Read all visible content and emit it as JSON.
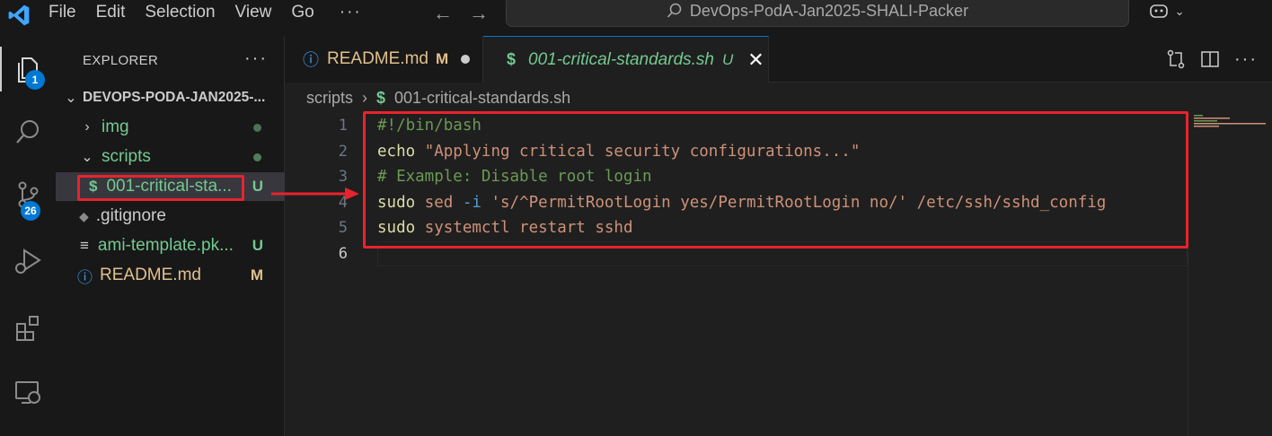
{
  "menu": {
    "items": [
      "File",
      "Edit",
      "Selection",
      "View",
      "Go"
    ],
    "more": "···"
  },
  "search": {
    "text": "DevOps-PodA-Jan2025-SHALI-Packer"
  },
  "activity_bar": {
    "explorer_badge": "1",
    "source_control_badge": "26"
  },
  "sidebar": {
    "title": "EXPLORER",
    "more": "···",
    "root": "DEVOPS-PODA-JAN2025-...",
    "items": [
      {
        "label": "img",
        "status": ""
      },
      {
        "label": "scripts",
        "status": ""
      },
      {
        "label": "001-critical-sta...",
        "status": "U"
      },
      {
        "label": ".gitignore",
        "status": ""
      },
      {
        "label": "ami-template.pk...",
        "status": "U"
      },
      {
        "label": "README.md",
        "status": "M"
      }
    ]
  },
  "tabs": [
    {
      "label": "README.md",
      "status": "M"
    },
    {
      "label": "001-critical-standards.sh",
      "status": "U"
    }
  ],
  "breadcrumb": {
    "folder": "scripts",
    "file": "001-critical-standards.sh"
  },
  "code": {
    "line_numbers": [
      "1",
      "2",
      "3",
      "4",
      "5",
      "6"
    ],
    "line1": "#!/bin/bash",
    "line2_cmd": "echo",
    "line2_str": "\"Applying critical security configurations...\"",
    "line3": "# Example: Disable root login",
    "line4_cmd": "sudo",
    "line4_arg": "sed",
    "line4_flag": "-i",
    "line4_str": "'s/^PermitRootLogin yes/PermitRootLogin no/'",
    "line4_path": "/etc/ssh/sshd_config",
    "line5_cmd": "sudo",
    "line5_rest": "systemctl restart sshd"
  },
  "colors": {
    "accent": "#0078d4",
    "annotation_red": "#e8232d",
    "untracked_green": "#73c991",
    "modified_yellow": "#e2c08d"
  }
}
